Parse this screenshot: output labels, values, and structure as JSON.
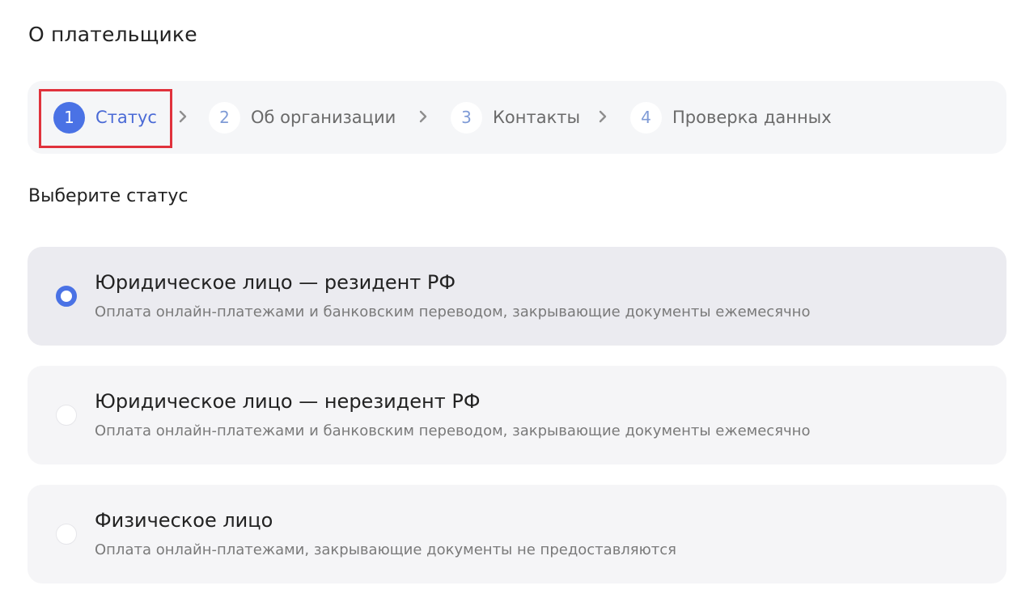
{
  "page": {
    "title": "О плательщике"
  },
  "stepper": {
    "steps": [
      {
        "num": "1",
        "label": "Статус",
        "active": true
      },
      {
        "num": "2",
        "label": "Об организации",
        "active": false
      },
      {
        "num": "3",
        "label": "Контакты",
        "active": false
      },
      {
        "num": "4",
        "label": "Проверка данных",
        "active": false
      }
    ]
  },
  "section": {
    "title": "Выберите статус"
  },
  "options": [
    {
      "title": "Юридическое лицо — резидент РФ",
      "desc": "Оплата онлайн-платежами и банковским переводом, закрывающие документы ежемесячно",
      "selected": true
    },
    {
      "title": "Юридическое лицо — нерезидент РФ",
      "desc": "Оплата онлайн-платежами и банковским переводом, закрывающие документы ежемесячно",
      "selected": false
    },
    {
      "title": "Физическое лицо",
      "desc": "Оплата онлайн-платежами, закрывающие документы не предоставляются",
      "selected": false
    }
  ],
  "colors": {
    "accent": "#4a72e5",
    "highlight": "#e0323c",
    "panel_bg": "#f5f6f8",
    "selected_bg": "#ebebf0"
  }
}
